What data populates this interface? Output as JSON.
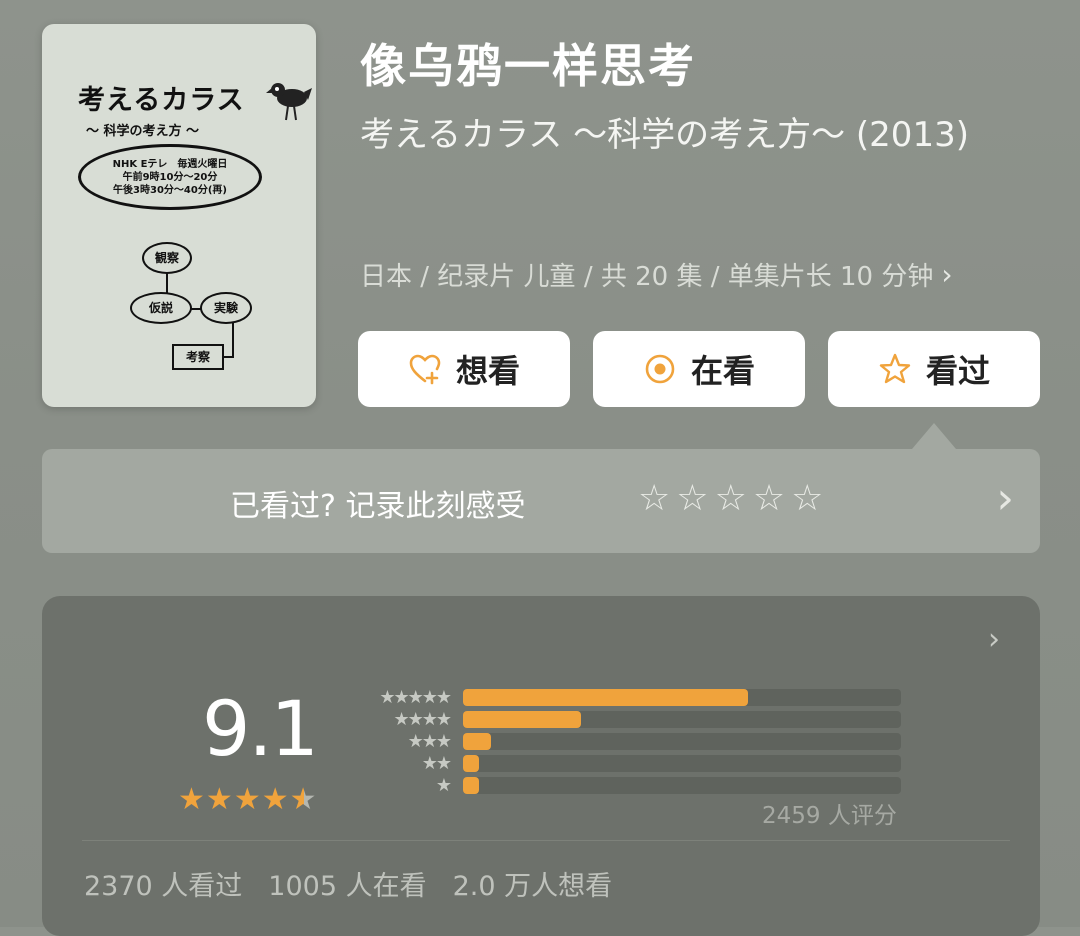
{
  "poster": {
    "title": "考えるカラス",
    "subtitle": "〜 科学の考え方 〜",
    "schedule_lines": [
      "NHK Eテレ　毎週火曜日",
      "午前9時10分〜20分",
      "午後3時30分〜40分(再)"
    ],
    "diagram": [
      "観察",
      "仮説",
      "実験",
      "考察"
    ]
  },
  "movie": {
    "title": "像乌鸦一样思考",
    "original_title": "考えるカラス ～科学の考え方～ (2013)",
    "meta": "日本 / 纪录片 儿童 / 共 20 集 / 单集片长 10 分钟"
  },
  "actions": {
    "want_label": "想看",
    "watching_label": "在看",
    "watched_label": "看过",
    "want_icon": "heart-plus-icon",
    "watching_icon": "target-circle-icon",
    "watched_icon": "star-outline-icon"
  },
  "rate_prompt": {
    "text": "已看过? 记录此刻感受",
    "stars": 5
  },
  "rating": {
    "score": "9.1",
    "stars": 4.5,
    "distribution": [
      {
        "stars": "★★★★★",
        "fraction": 0.65
      },
      {
        "stars": "★★★★",
        "fraction": 0.27
      },
      {
        "stars": "★★★",
        "fraction": 0.065
      },
      {
        "stars": "★★",
        "fraction": 0.035
      },
      {
        "stars": "★",
        "fraction": 0.035
      }
    ],
    "raters": "2459 人评分"
  },
  "stats": {
    "watched": "2370 人看过",
    "watching": "1005 人在看",
    "want": "2.0 万人想看"
  },
  "colors": {
    "accent": "#f0a33c",
    "background": "#8a8f88",
    "card": "#6d716b"
  }
}
